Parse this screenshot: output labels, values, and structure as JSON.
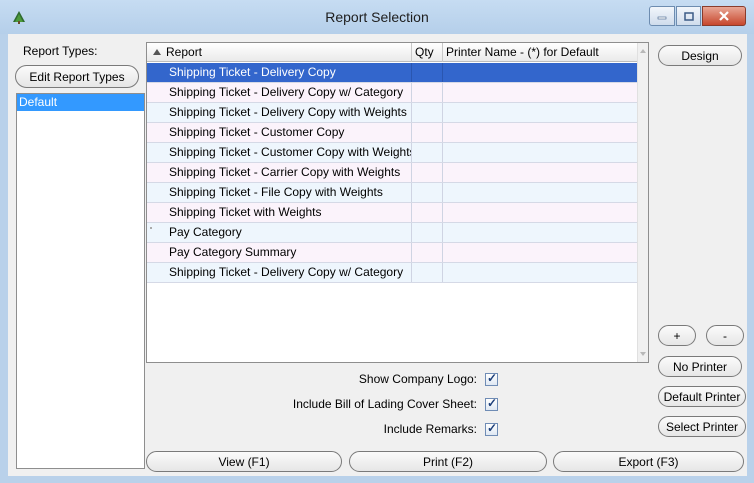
{
  "window": {
    "title": "Report Selection",
    "icon": "tree-icon"
  },
  "left": {
    "report_types_label": "Report Types:",
    "edit_button": "Edit Report Types",
    "types": [
      "Default"
    ]
  },
  "grid": {
    "columns": [
      "Report",
      "Qty",
      "Printer Name - (*) for Default"
    ],
    "rows": [
      {
        "report": "Shipping Ticket - Delivery Copy",
        "qty": "",
        "printer": ""
      },
      {
        "report": "Shipping Ticket - Delivery Copy w/ Category",
        "qty": "",
        "printer": ""
      },
      {
        "report": "Shipping Ticket - Delivery Copy with Weights",
        "qty": "",
        "printer": ""
      },
      {
        "report": "Shipping Ticket - Customer Copy",
        "qty": "",
        "printer": ""
      },
      {
        "report": "Shipping Ticket - Customer Copy with Weights",
        "qty": "",
        "printer": ""
      },
      {
        "report": "Shipping Ticket - Carrier Copy with Weights",
        "qty": "",
        "printer": ""
      },
      {
        "report": "Shipping Ticket - File Copy with Weights",
        "qty": "",
        "printer": ""
      },
      {
        "report": "Shipping Ticket with Weights",
        "qty": "",
        "printer": ""
      },
      {
        "report": "Pay Category",
        "qty": "",
        "printer": ""
      },
      {
        "report": "Pay Category Summary",
        "qty": "",
        "printer": ""
      },
      {
        "report": "Shipping Ticket - Delivery Copy w/ Category",
        "qty": "",
        "printer": ""
      }
    ],
    "selected_index": 0
  },
  "right": {
    "design": "Design",
    "plus": "+",
    "minus": "-",
    "no_printer": "No Printer",
    "default_printer": "Default Printer",
    "select_printer": "Select Printer"
  },
  "options": [
    {
      "label": "Show Company Logo:",
      "checked": true
    },
    {
      "label": "Include Bill of Lading Cover Sheet:",
      "checked": true
    },
    {
      "label": "Include Remarks:",
      "checked": true
    }
  ],
  "bottom": {
    "view": "View (F1)",
    "print": "Print (F2)",
    "export": "Export (F3)"
  },
  "colors": {
    "selection": "#3366cc",
    "list_selection": "#3399ff",
    "frame": "#b9d1ea"
  }
}
